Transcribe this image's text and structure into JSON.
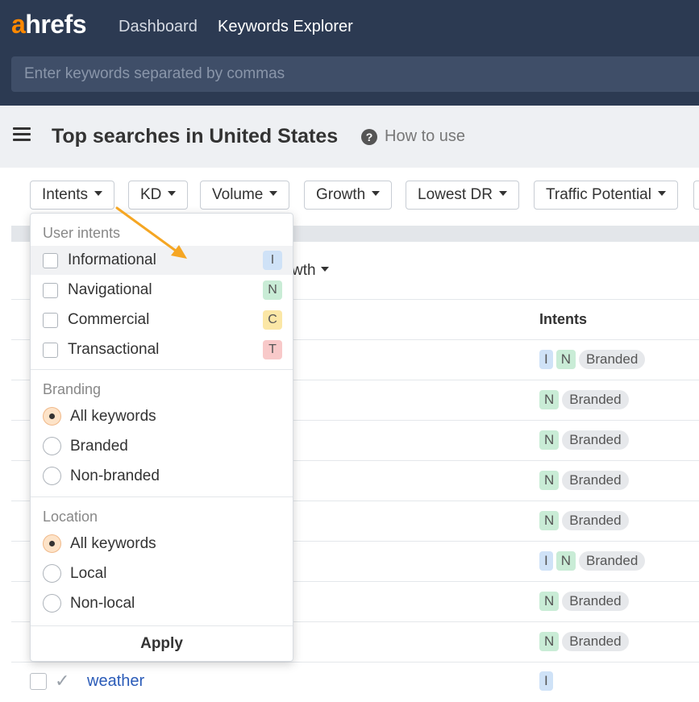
{
  "app": {
    "logo_first": "a",
    "logo_rest": "hrefs",
    "nav": [
      "Dashboard",
      "Keywords Explorer"
    ],
    "search_placeholder": "Enter keywords separated by commas",
    "accent_color": "#ff8800"
  },
  "page": {
    "title": "Top searches in United States",
    "help_icon": "question-circle-icon",
    "help_label": "How to use"
  },
  "filters": [
    "Intents",
    "KD",
    "Volume",
    "Growth",
    "Lowest DR",
    "Traffic Potential"
  ],
  "table": {
    "growth_partial_label": "wth",
    "intents_header": "Intents",
    "rows": [
      {
        "tags": [
          "I",
          "N",
          "Branded"
        ]
      },
      {
        "tags": [
          "N",
          "Branded"
        ]
      },
      {
        "tags": [
          "N",
          "Branded"
        ]
      },
      {
        "tags": [
          "N",
          "Branded"
        ]
      },
      {
        "tags": [
          "N",
          "Branded"
        ]
      },
      {
        "tags": [
          "I",
          "N",
          "Branded"
        ]
      },
      {
        "tags": [
          "N",
          "Branded"
        ]
      },
      {
        "tags": [
          "N",
          "Branded"
        ]
      }
    ],
    "last_row": {
      "keyword": "weather",
      "tags": [
        "I"
      ]
    }
  },
  "dropdown": {
    "user_intents_label": "User intents",
    "intents": [
      {
        "label": "Informational",
        "badge": "I"
      },
      {
        "label": "Navigational",
        "badge": "N"
      },
      {
        "label": "Commercial",
        "badge": "C"
      },
      {
        "label": "Transactional",
        "badge": "T"
      }
    ],
    "branding_label": "Branding",
    "branding": [
      "All keywords",
      "Branded",
      "Non-branded"
    ],
    "branding_selected": "All keywords",
    "location_label": "Location",
    "location": [
      "All keywords",
      "Local",
      "Non-local"
    ],
    "location_selected": "All keywords",
    "apply_label": "Apply"
  }
}
